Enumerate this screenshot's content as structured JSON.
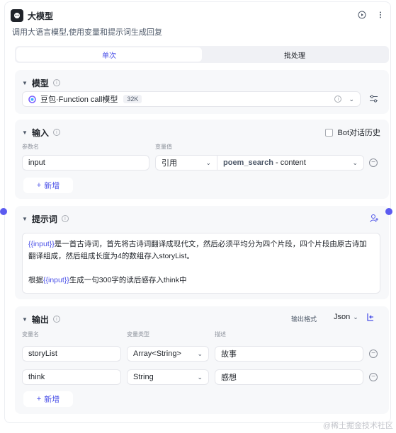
{
  "node": {
    "title": "大模型",
    "description": "调用大语言模型,使用变量和提示词生成回复"
  },
  "tabs": [
    {
      "label": "单次",
      "active": true
    },
    {
      "label": "批处理",
      "active": false
    }
  ],
  "model": {
    "section_title": "模型",
    "selected_model": "豆包·Function call模型",
    "context_badge": "32K"
  },
  "input": {
    "section_title": "输入",
    "bot_history_label": "Bot对话历史",
    "bot_history_checked": false,
    "col_param": "参数名",
    "col_value": "变量值",
    "rows": [
      {
        "name": "input",
        "mode": "引用",
        "ref_node": "poem_search",
        "ref_sep": " - ",
        "ref_field": "content"
      }
    ],
    "add_label": "新增"
  },
  "prompt": {
    "section_title": "提示词",
    "line1_var": "{{input}}",
    "line1_text": "是一首古诗词，首先将古诗词翻译成现代文，然后必须平均分为四个片段，四个片段由原古诗加翻译组成，然后组成长度为4的数组存入storyList。",
    "line2_prefix": "根据",
    "line2_var": "{{input}}",
    "line2_text": "生成一句300字的读后感存入think中"
  },
  "output": {
    "section_title": "输出",
    "format_label": "输出格式",
    "format_value": "Json",
    "col_name": "变量名",
    "col_type": "变量类型",
    "col_desc": "描述",
    "rows": [
      {
        "name": "storyList",
        "type": "Array<String>",
        "desc": "故事"
      },
      {
        "name": "think",
        "type": "String",
        "desc": "感想"
      }
    ],
    "add_label": "新增"
  },
  "watermark": "@稀土掘金技术社区",
  "colors": {
    "accent": "#4d53e8",
    "handle": "#5b5bf0",
    "section_bg": "#f7f8fa"
  }
}
